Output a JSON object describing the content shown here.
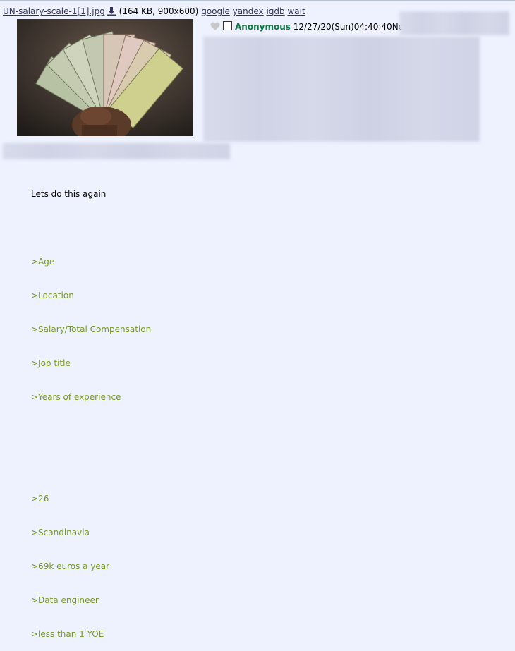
{
  "file": {
    "filename": "UN-salary-scale-1[1].jpg",
    "meta": "(164 KB, 900x600)",
    "search_links": [
      "google",
      "yandex",
      "iqdb",
      "wait"
    ]
  },
  "post": {
    "name": "Anonymous",
    "datetime": "12/27/20(Sun)04:40:40",
    "number_prefix": "No",
    "body": [
      {
        "text": "Lets do this again",
        "type": "text"
      },
      {
        "text": "",
        "type": "blank"
      },
      {
        "text": ">Age",
        "type": "quote"
      },
      {
        "text": ">Location",
        "type": "quote"
      },
      {
        "text": ">Salary/Total Compensation",
        "type": "quote"
      },
      {
        "text": ">Job title",
        "type": "quote"
      },
      {
        "text": ">Years of experience",
        "type": "quote"
      },
      {
        "text": "",
        "type": "blank"
      },
      {
        "text": "",
        "type": "blank"
      },
      {
        "text": ">26",
        "type": "quote"
      },
      {
        "text": ">Scandinavia",
        "type": "quote"
      },
      {
        "text": ">69k euros a year",
        "type": "quote"
      },
      {
        "text": ">Data engineer",
        "type": "quote"
      },
      {
        "text": ">less than 1 YOE",
        "type": "quote"
      }
    ]
  },
  "colors": {
    "background": "#eef2ff",
    "link": "#34345c",
    "name": "#117743",
    "greentext": "#789922"
  },
  "icons": [
    "download-icon",
    "heart-icon"
  ]
}
